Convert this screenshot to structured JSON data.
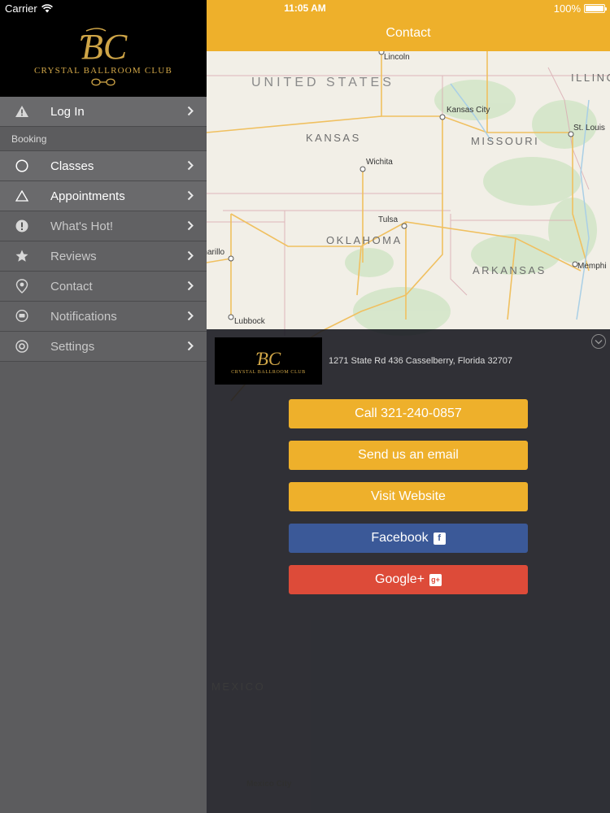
{
  "status_bar": {
    "carrier": "Carrier",
    "time": "11:05 AM",
    "battery": "100%"
  },
  "sidebar": {
    "brand": "Crystal Ballroom Club",
    "login_label": "Log In",
    "section_booking": "Booking",
    "items": [
      {
        "label": "Classes",
        "icon": "circle-icon"
      },
      {
        "label": "Appointments",
        "icon": "triangle-icon"
      },
      {
        "label": "What's Hot!",
        "icon": "exclamation-icon"
      },
      {
        "label": "Reviews",
        "icon": "star-icon"
      },
      {
        "label": "Contact",
        "icon": "location-pin-icon"
      },
      {
        "label": "Notifications",
        "icon": "chat-bubble-icon"
      },
      {
        "label": "Settings",
        "icon": "gear-icon"
      }
    ]
  },
  "navbar": {
    "title": "Contact"
  },
  "map": {
    "labels": {
      "country_us": "UNITED STATES",
      "country_mx": "MEXICO",
      "kansas": "KANSAS",
      "missouri": "MISSOURI",
      "oklahoma": "OKLAHOMA",
      "arkansas": "ARKANSAS",
      "illinois": "ILLINO",
      "lincoln": "Lincoln",
      "kansas_city": "Kansas City",
      "st_louis": "St. Louis",
      "wichita": "Wichita",
      "tulsa": "Tulsa",
      "amarillo": "Amarillo",
      "memphis": "Memphi",
      "lubbock": "Lubbock",
      "mexico_city": "Mexico City"
    }
  },
  "contact_panel": {
    "brand": "Crystal Ballroom Club",
    "address": "1271 State Rd 436 Casselberry, Florida 32707",
    "buttons": {
      "call": "Call 321-240-0857",
      "email": "Send us an email",
      "website": "Visit Website",
      "facebook": "Facebook",
      "google": "Google+"
    }
  },
  "colors": {
    "accent": "#eeb02b",
    "sidebar": "#5c5c5e",
    "facebook": "#3b5998",
    "google": "#dd4b39",
    "gold_logo": "#cfa547"
  }
}
